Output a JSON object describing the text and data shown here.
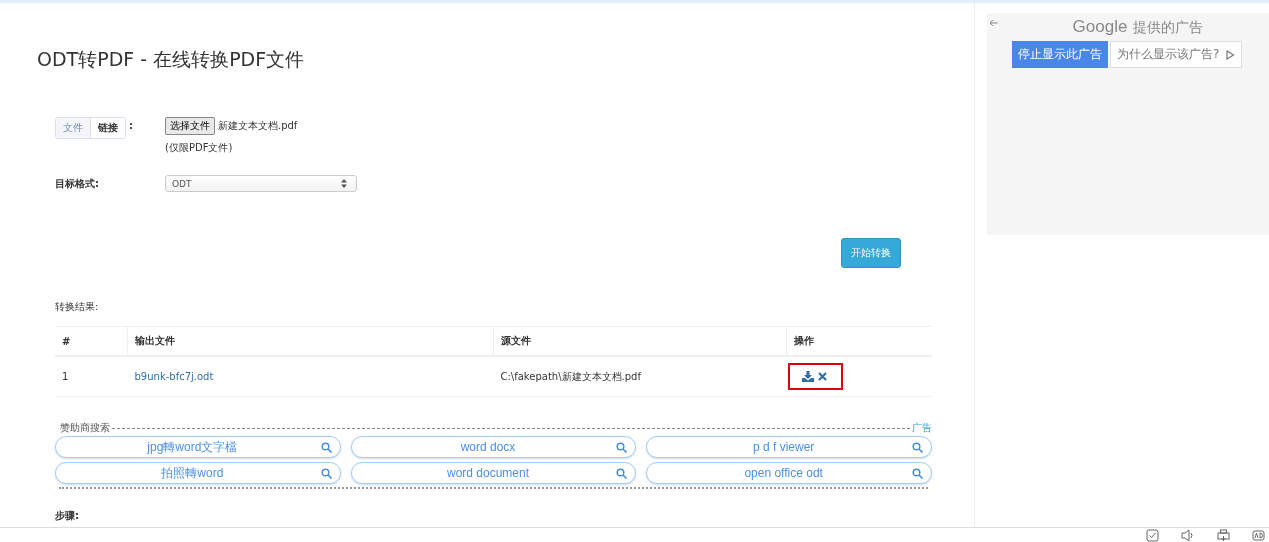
{
  "title": "ODT转PDF - 在线转换PDF文件",
  "source_tabs": [
    {
      "label": "文件",
      "selected": true
    },
    {
      "label": "链接",
      "selected": false
    }
  ],
  "source_colon": ":",
  "file_button": "选择文件",
  "file_name": "新建文本文档.pdf",
  "file_hint": "(仅限PDF文件)",
  "format_label": "目标格式:",
  "format_value": "ODT",
  "convert_button": "开始转换",
  "results_label": "转换结果:",
  "table": {
    "columns": [
      "#",
      "输出文件",
      "源文件",
      "操作"
    ],
    "rows": [
      {
        "index": "1",
        "output": "b9unk-bfc7j.odt",
        "source": "C:\\fakepath\\新建文本文档.pdf",
        "highlighted": true
      }
    ]
  },
  "sponsored": {
    "label": "赞助商搜索",
    "ad_mark": "广告",
    "terms": [
      "jpg轉word文字檔",
      "word docx",
      "p d f viewer",
      "拍照轉word",
      "word document",
      "open office odt"
    ]
  },
  "steps_label": "步骤:",
  "ad_panel": {
    "provider": "Google",
    "provider_suffix": "提供的广告",
    "stop_button": "停止显示此广告",
    "why_button": "为什么显示该广告?"
  }
}
